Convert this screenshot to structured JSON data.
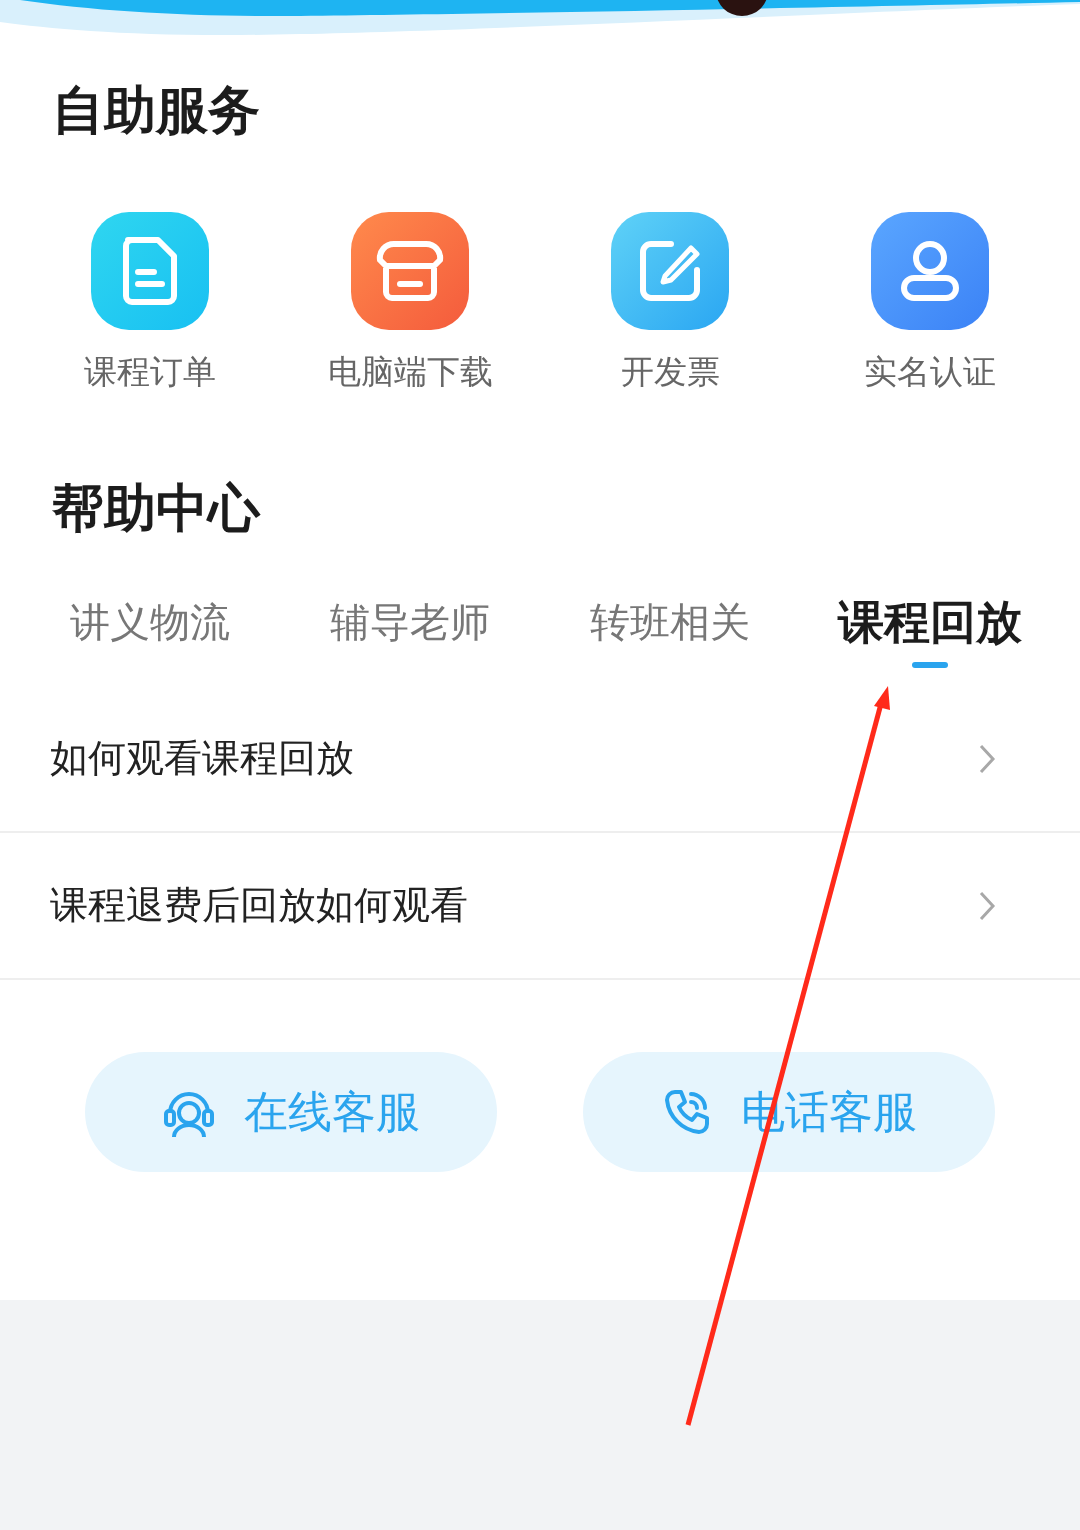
{
  "self_service": {
    "title": "自助服务",
    "items": [
      {
        "label": "课程订单",
        "kind": "document"
      },
      {
        "label": "电脑端下载",
        "kind": "box"
      },
      {
        "label": "开发票",
        "kind": "edit"
      },
      {
        "label": "实名认证",
        "kind": "person"
      }
    ]
  },
  "help_center": {
    "title": "帮助中心",
    "tabs": [
      {
        "label": "讲义物流",
        "selected": false
      },
      {
        "label": "辅导老师",
        "selected": false
      },
      {
        "label": "转班相关",
        "selected": false
      },
      {
        "label": "课程回放",
        "selected": true
      }
    ],
    "questions": [
      {
        "text": "如何观看课程回放"
      },
      {
        "text": "课程退费后回放如何观看"
      }
    ]
  },
  "contact_buttons": [
    {
      "label": "在线客服",
      "kind": "headset"
    },
    {
      "label": "电话客服",
      "kind": "phone"
    }
  ],
  "annotations": [
    {
      "kind": "arrow"
    }
  ]
}
